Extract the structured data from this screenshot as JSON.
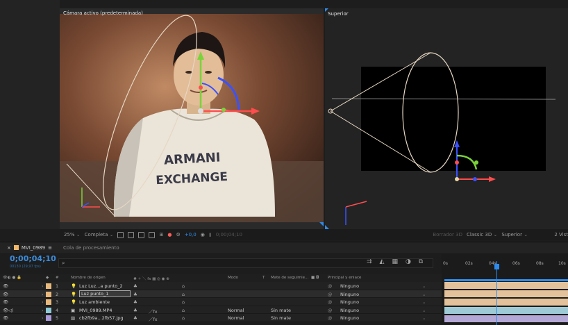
{
  "viewers": {
    "left_title": "Cámara activo (predeterminada)",
    "right_title": "Superior"
  },
  "viewer_toolbar": {
    "zoom": "25%",
    "resolution": "Completa",
    "exposure": "+0,0",
    "timecode": "0;00;04;10",
    "draft": "Borrador 3D",
    "renderer": "Classic 3D",
    "view": "Superior",
    "views_count": "2 Vist"
  },
  "panel": {
    "comp_tab": "MVI_0989",
    "queue_tab": "Cola de procesamiento",
    "timecode": "0;00;04;10",
    "timecode_sub": "00130 (29,97 fps)",
    "search_placeholder": ""
  },
  "columns": {
    "source_name": "Nombre de origen",
    "mode": "Modo",
    "trkmat": "T",
    "track_matte": "Mate de seguimie...",
    "parent": "Principal y enlace",
    "num": "#"
  },
  "layers": [
    {
      "num": "1",
      "name": "Luz Luz...a punto_2",
      "icon": "light-icon",
      "label_color": "#e8b87c",
      "mode": "",
      "mate": "",
      "parent": "Ninguno"
    },
    {
      "num": "2",
      "name": "Luz punto_1",
      "icon": "light-icon",
      "label_color": "#e8b87c",
      "mode": "",
      "mate": "",
      "parent": "Ninguno"
    },
    {
      "num": "3",
      "name": "Luz ambiente",
      "icon": "light-icon",
      "label_color": "#e8b87c",
      "mode": "",
      "mate": "",
      "parent": "Ninguno"
    },
    {
      "num": "4",
      "name": "MVI_0989.MP4",
      "icon": "footage-icon",
      "label_color": "#8ec9d6",
      "mode": "Normal",
      "mate": "Sin mate",
      "parent": "Ninguno"
    },
    {
      "num": "5",
      "name": "cb2fb9a...2fb57.jpg",
      "icon": "image-icon",
      "label_color": "#aa9ad8",
      "mode": "Normal",
      "mate": "Sin mate",
      "parent": "Ninguno"
    }
  ],
  "timeline": {
    "ticks": [
      "0s",
      "02s",
      "04s",
      "06s",
      "08s",
      "10s"
    ],
    "colors": {
      "timecode": "#3c8ddb",
      "cti": "#2d8ceb",
      "light_bar": "#e3c29b",
      "footage_bar": "#9ecbd5",
      "image_bar": "#b4a8d6"
    }
  }
}
